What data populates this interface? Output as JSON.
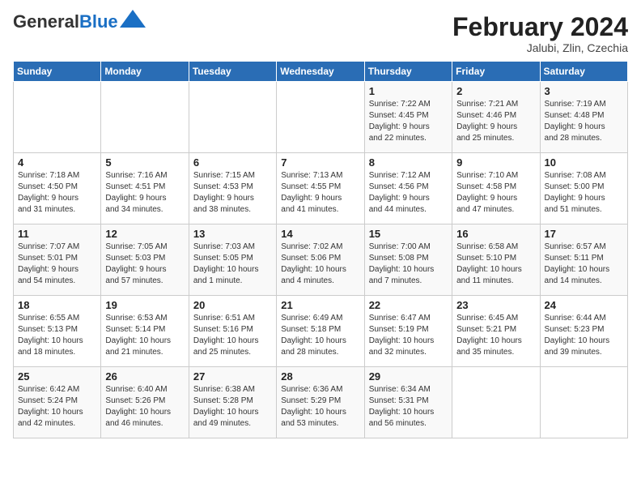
{
  "header": {
    "logo_general": "General",
    "logo_blue": "Blue",
    "month_title": "February 2024",
    "location": "Jalubi, Zlin, Czechia"
  },
  "days_of_week": [
    "Sunday",
    "Monday",
    "Tuesday",
    "Wednesday",
    "Thursday",
    "Friday",
    "Saturday"
  ],
  "weeks": [
    [
      {
        "day": "",
        "info": ""
      },
      {
        "day": "",
        "info": ""
      },
      {
        "day": "",
        "info": ""
      },
      {
        "day": "",
        "info": ""
      },
      {
        "day": "1",
        "info": "Sunrise: 7:22 AM\nSunset: 4:45 PM\nDaylight: 9 hours\nand 22 minutes."
      },
      {
        "day": "2",
        "info": "Sunrise: 7:21 AM\nSunset: 4:46 PM\nDaylight: 9 hours\nand 25 minutes."
      },
      {
        "day": "3",
        "info": "Sunrise: 7:19 AM\nSunset: 4:48 PM\nDaylight: 9 hours\nand 28 minutes."
      }
    ],
    [
      {
        "day": "4",
        "info": "Sunrise: 7:18 AM\nSunset: 4:50 PM\nDaylight: 9 hours\nand 31 minutes."
      },
      {
        "day": "5",
        "info": "Sunrise: 7:16 AM\nSunset: 4:51 PM\nDaylight: 9 hours\nand 34 minutes."
      },
      {
        "day": "6",
        "info": "Sunrise: 7:15 AM\nSunset: 4:53 PM\nDaylight: 9 hours\nand 38 minutes."
      },
      {
        "day": "7",
        "info": "Sunrise: 7:13 AM\nSunset: 4:55 PM\nDaylight: 9 hours\nand 41 minutes."
      },
      {
        "day": "8",
        "info": "Sunrise: 7:12 AM\nSunset: 4:56 PM\nDaylight: 9 hours\nand 44 minutes."
      },
      {
        "day": "9",
        "info": "Sunrise: 7:10 AM\nSunset: 4:58 PM\nDaylight: 9 hours\nand 47 minutes."
      },
      {
        "day": "10",
        "info": "Sunrise: 7:08 AM\nSunset: 5:00 PM\nDaylight: 9 hours\nand 51 minutes."
      }
    ],
    [
      {
        "day": "11",
        "info": "Sunrise: 7:07 AM\nSunset: 5:01 PM\nDaylight: 9 hours\nand 54 minutes."
      },
      {
        "day": "12",
        "info": "Sunrise: 7:05 AM\nSunset: 5:03 PM\nDaylight: 9 hours\nand 57 minutes."
      },
      {
        "day": "13",
        "info": "Sunrise: 7:03 AM\nSunset: 5:05 PM\nDaylight: 10 hours\nand 1 minute."
      },
      {
        "day": "14",
        "info": "Sunrise: 7:02 AM\nSunset: 5:06 PM\nDaylight: 10 hours\nand 4 minutes."
      },
      {
        "day": "15",
        "info": "Sunrise: 7:00 AM\nSunset: 5:08 PM\nDaylight: 10 hours\nand 7 minutes."
      },
      {
        "day": "16",
        "info": "Sunrise: 6:58 AM\nSunset: 5:10 PM\nDaylight: 10 hours\nand 11 minutes."
      },
      {
        "day": "17",
        "info": "Sunrise: 6:57 AM\nSunset: 5:11 PM\nDaylight: 10 hours\nand 14 minutes."
      }
    ],
    [
      {
        "day": "18",
        "info": "Sunrise: 6:55 AM\nSunset: 5:13 PM\nDaylight: 10 hours\nand 18 minutes."
      },
      {
        "day": "19",
        "info": "Sunrise: 6:53 AM\nSunset: 5:14 PM\nDaylight: 10 hours\nand 21 minutes."
      },
      {
        "day": "20",
        "info": "Sunrise: 6:51 AM\nSunset: 5:16 PM\nDaylight: 10 hours\nand 25 minutes."
      },
      {
        "day": "21",
        "info": "Sunrise: 6:49 AM\nSunset: 5:18 PM\nDaylight: 10 hours\nand 28 minutes."
      },
      {
        "day": "22",
        "info": "Sunrise: 6:47 AM\nSunset: 5:19 PM\nDaylight: 10 hours\nand 32 minutes."
      },
      {
        "day": "23",
        "info": "Sunrise: 6:45 AM\nSunset: 5:21 PM\nDaylight: 10 hours\nand 35 minutes."
      },
      {
        "day": "24",
        "info": "Sunrise: 6:44 AM\nSunset: 5:23 PM\nDaylight: 10 hours\nand 39 minutes."
      }
    ],
    [
      {
        "day": "25",
        "info": "Sunrise: 6:42 AM\nSunset: 5:24 PM\nDaylight: 10 hours\nand 42 minutes."
      },
      {
        "day": "26",
        "info": "Sunrise: 6:40 AM\nSunset: 5:26 PM\nDaylight: 10 hours\nand 46 minutes."
      },
      {
        "day": "27",
        "info": "Sunrise: 6:38 AM\nSunset: 5:28 PM\nDaylight: 10 hours\nand 49 minutes."
      },
      {
        "day": "28",
        "info": "Sunrise: 6:36 AM\nSunset: 5:29 PM\nDaylight: 10 hours\nand 53 minutes."
      },
      {
        "day": "29",
        "info": "Sunrise: 6:34 AM\nSunset: 5:31 PM\nDaylight: 10 hours\nand 56 minutes."
      },
      {
        "day": "",
        "info": ""
      },
      {
        "day": "",
        "info": ""
      }
    ]
  ]
}
